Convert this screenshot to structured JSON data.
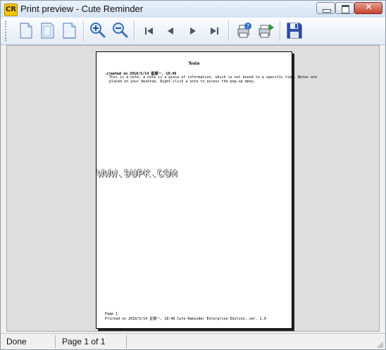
{
  "window": {
    "title": "Print preview - Cute Reminder",
    "app_icon_label": "CR"
  },
  "toolbar": {
    "buttons": [
      {
        "icon": "one-page-icon"
      },
      {
        "icon": "two-pages-icon"
      },
      {
        "icon": "multi-page-icon"
      },
      {
        "icon": "zoom-in-icon"
      },
      {
        "icon": "zoom-out-icon"
      },
      {
        "icon": "first-page-icon"
      },
      {
        "icon": "previous-page-icon"
      },
      {
        "icon": "next-page-icon"
      },
      {
        "icon": "last-page-icon"
      },
      {
        "icon": "print-setup-icon"
      },
      {
        "icon": "print-icon"
      },
      {
        "icon": "save-icon"
      }
    ]
  },
  "page": {
    "title": "Note",
    "created_line": "created on 2018/5/14 星期一, 18:48",
    "body_line_1": "This is a note, a note is a piece of information, which is not bound to a specific time. Notes are",
    "body_line_2": "placed on your desktop. Right-click a note to access the pop-up menu.",
    "footer_page": "Page 1",
    "footer_printed": "Printed on 2018/5/14 星期一, 18:48      Cute Reminder Enterprise Edition, ver. 2.9"
  },
  "watermark": "WWW.9UPK.COM",
  "status": {
    "state": "Done",
    "page_info": "Page 1 of 1"
  },
  "colors": {
    "toolbar_icon_blue": "#3f6fb5",
    "save_icon_blue": "#2f4fa8",
    "print_green": "#2f9a3a"
  }
}
